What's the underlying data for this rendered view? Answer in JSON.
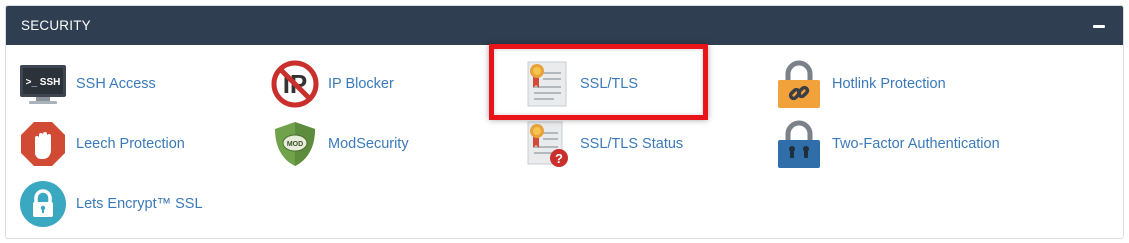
{
  "panel": {
    "title": "SECURITY",
    "collapse_label": "−"
  },
  "items": [
    {
      "label": "SSH Access",
      "icon": "terminal-icon",
      "icon_text": ">_ SSH"
    },
    {
      "label": "IP Blocker",
      "icon": "ip-blocker-icon",
      "icon_text": "IP"
    },
    {
      "label": "SSL/TLS",
      "icon": "certificate-icon",
      "highlighted": true
    },
    {
      "label": "Hotlink Protection",
      "icon": "padlock-link-icon"
    },
    {
      "label": "Leech Protection",
      "icon": "stop-hand-icon"
    },
    {
      "label": "ModSecurity",
      "icon": "shield-icon",
      "icon_text": "MOD"
    },
    {
      "label": "SSL/TLS Status",
      "icon": "certificate-status-icon"
    },
    {
      "label": "Two-Factor Authentication",
      "icon": "padlock-icon"
    },
    {
      "label": "Lets Encrypt™ SSL",
      "icon": "lets-encrypt-lock-icon"
    }
  ],
  "colors": {
    "header_bg": "#2f3f51",
    "link": "#3b7ab8",
    "highlight": "#e8141a"
  }
}
